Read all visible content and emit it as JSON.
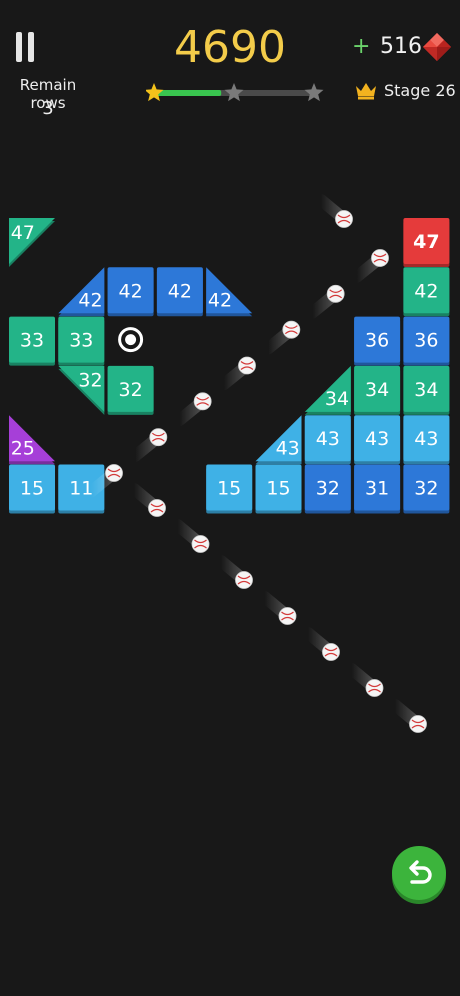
{
  "hud": {
    "remain_label": "Remain rows",
    "remain_count": "3",
    "score": "4690",
    "gem_plus": "+",
    "gems": "516",
    "stage_label": "Stage 26",
    "stars_total": 3,
    "stars_earned": 1,
    "progress": 0.42
  },
  "colors": {
    "cyan": "#3fb1e6",
    "blue": "#2d78d8",
    "green": "#23b488",
    "red": "#e53b3b",
    "purple": "#a63fd8",
    "score": "#f3cc4a",
    "progress_fill": "#39c54f",
    "undo": "#3cb43c"
  },
  "icons": {
    "pause": "pause-icon",
    "gem": "red-gem-icon",
    "crown": "crown-icon",
    "star": "star-icon",
    "undo": "undo-arrow-icon",
    "ball": "baseball-icon",
    "bonus_ring": "extra-ball-ring-icon"
  },
  "blocks": [
    {
      "row": 0,
      "col": 0,
      "shape": "tri-tl",
      "label": "47",
      "color": "green"
    },
    {
      "row": 0,
      "col": 8,
      "shape": "square",
      "label": "47",
      "color": "red"
    },
    {
      "row": 1,
      "col": 1,
      "shape": "tri-br",
      "label": "42",
      "color": "blue"
    },
    {
      "row": 1,
      "col": 2,
      "shape": "square",
      "label": "42",
      "color": "blue"
    },
    {
      "row": 1,
      "col": 3,
      "shape": "square",
      "label": "42",
      "color": "blue"
    },
    {
      "row": 1,
      "col": 4,
      "shape": "tri-bl",
      "label": "42",
      "color": "blue"
    },
    {
      "row": 1,
      "col": 8,
      "shape": "square",
      "label": "42",
      "color": "green"
    },
    {
      "row": 2,
      "col": 0,
      "shape": "square",
      "label": "33",
      "color": "green"
    },
    {
      "row": 2,
      "col": 1,
      "shape": "square",
      "label": "33",
      "color": "green"
    },
    {
      "row": 2,
      "col": 7,
      "shape": "square",
      "label": "36",
      "color": "blue"
    },
    {
      "row": 2,
      "col": 8,
      "shape": "square",
      "label": "36",
      "color": "blue"
    },
    {
      "row": 3,
      "col": 1,
      "shape": "tri-tr",
      "label": "32",
      "color": "green"
    },
    {
      "row": 3,
      "col": 2,
      "shape": "square",
      "label": "32",
      "color": "green"
    },
    {
      "row": 3,
      "col": 6,
      "shape": "tri-br",
      "label": "34",
      "color": "green"
    },
    {
      "row": 3,
      "col": 7,
      "shape": "square",
      "label": "34",
      "color": "green"
    },
    {
      "row": 3,
      "col": 8,
      "shape": "square",
      "label": "34",
      "color": "green"
    },
    {
      "row": 4,
      "col": 0,
      "shape": "tri-bl",
      "label": "25",
      "color": "purple"
    },
    {
      "row": 4,
      "col": 5,
      "shape": "tri-br",
      "label": "43",
      "color": "cyan"
    },
    {
      "row": 4,
      "col": 6,
      "shape": "square",
      "label": "43",
      "color": "cyan"
    },
    {
      "row": 4,
      "col": 7,
      "shape": "square",
      "label": "43",
      "color": "cyan"
    },
    {
      "row": 4,
      "col": 8,
      "shape": "square",
      "label": "43",
      "color": "cyan"
    },
    {
      "row": 5,
      "col": 0,
      "shape": "square",
      "label": "15",
      "color": "cyan"
    },
    {
      "row": 5,
      "col": 1,
      "shape": "square",
      "label": "11",
      "color": "cyan"
    },
    {
      "row": 5,
      "col": 4,
      "shape": "square",
      "label": "15",
      "color": "cyan"
    },
    {
      "row": 5,
      "col": 5,
      "shape": "square",
      "label": "15",
      "color": "cyan"
    },
    {
      "row": 5,
      "col": 6,
      "shape": "square",
      "label": "32",
      "color": "blue"
    },
    {
      "row": 5,
      "col": 7,
      "shape": "square",
      "label": "31",
      "color": "blue"
    },
    {
      "row": 5,
      "col": 8,
      "shape": "square",
      "label": "32",
      "color": "blue"
    }
  ],
  "bonus": [
    {
      "row": 2,
      "col": 2
    }
  ],
  "balls_count": 16
}
